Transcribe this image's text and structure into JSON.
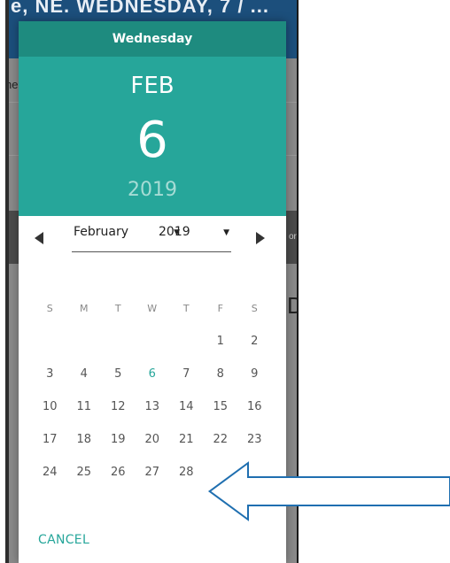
{
  "background": {
    "title_fragment": "e, NE. WEDNESDAY, 7 / ...",
    "left_fragment": "he",
    "right_fragment": "D",
    "right_band_fragment": "or"
  },
  "dialog": {
    "weekday": "Wednesday",
    "month_short": "FEB",
    "day": "6",
    "year": "2019",
    "month_select": "February",
    "year_select": "2019",
    "weekday_headers": [
      "S",
      "M",
      "T",
      "W",
      "T",
      "F",
      "S"
    ],
    "weeks": [
      [
        "",
        "",
        "",
        "",
        "",
        "1",
        "2"
      ],
      [
        "3",
        "4",
        "5",
        "6",
        "7",
        "8",
        "9"
      ],
      [
        "10",
        "11",
        "12",
        "13",
        "14",
        "15",
        "16"
      ],
      [
        "17",
        "18",
        "19",
        "20",
        "21",
        "22",
        "23"
      ],
      [
        "24",
        "25",
        "26",
        "27",
        "28",
        "",
        ""
      ]
    ],
    "selected_day": "6",
    "cancel_label": "CANCEL"
  },
  "colors": {
    "header_dark": "#1e8b7f",
    "header": "#26a69a",
    "accent": "#26a69a",
    "app_bar": "#1c4f7c",
    "annotation_arrow": "#1f6fb0"
  }
}
